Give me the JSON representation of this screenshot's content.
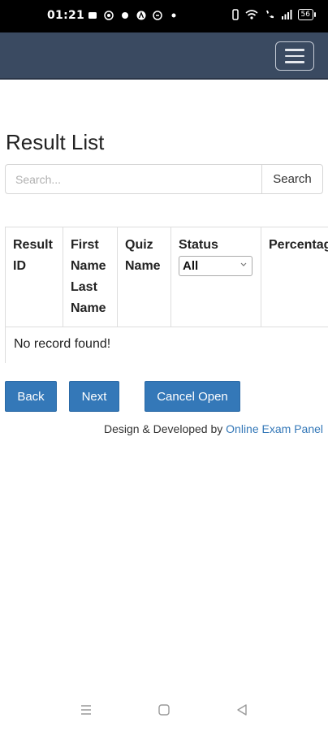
{
  "status_bar": {
    "time": "01:21",
    "battery": "56",
    "icons_left": [
      "message-icon",
      "whatsapp-icon",
      "dot-icon",
      "a-icon",
      "app-icon",
      "dot-icon"
    ],
    "icons_right": [
      "vibrate-icon",
      "wifi-icon",
      "call-icon",
      "signal-icon",
      "battery-icon"
    ]
  },
  "navbar": {
    "bg_color": "#3a4a61",
    "toggle_icon": "hamburger-menu-icon"
  },
  "page": {
    "title": "Result List"
  },
  "search": {
    "placeholder": "Search...",
    "value": "",
    "button_label": "Search"
  },
  "table": {
    "headers": {
      "result_id": "Result ID",
      "first_name": "First Name Last Name",
      "quiz_name": "Quiz Name",
      "status": "Status",
      "percentage": "Percentage"
    },
    "status_filter": {
      "selected": "All"
    },
    "empty_message": "No record found!"
  },
  "buttons": {
    "back": "Back",
    "next": "Next",
    "cancel_open": "Cancel Open",
    "color": "#3478b8"
  },
  "footer": {
    "prefix": "Design & Developed by ",
    "link": "Online Exam Panel"
  },
  "android_nav": {
    "icons": [
      "recents-icon",
      "home-icon",
      "back-icon"
    ]
  }
}
